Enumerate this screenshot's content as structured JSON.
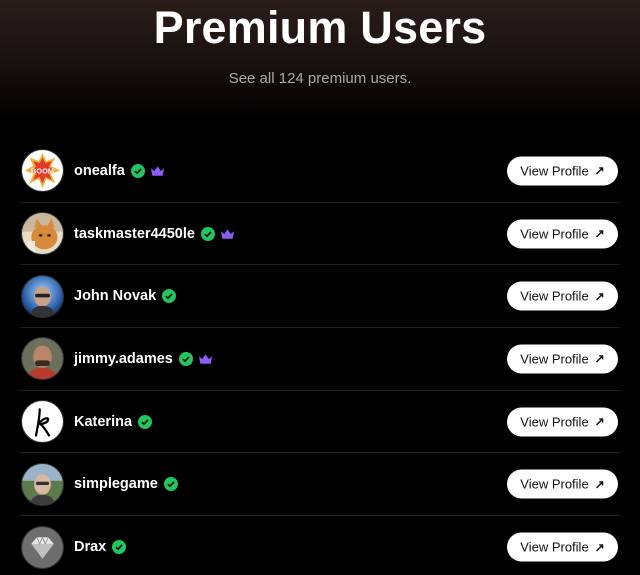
{
  "header": {
    "title": "Premium Users",
    "subtitle": "See all 124 premium users."
  },
  "colors": {
    "verified": "#22c55e",
    "crown": "#8b5cf6",
    "button_bg": "#ffffff",
    "background": "#000000"
  },
  "users": [
    {
      "name": "onealfa",
      "verified": true,
      "premium_crown": true,
      "avatar": "boom-comic-avatar",
      "button": "View Profile"
    },
    {
      "name": "taskmaster4450le",
      "verified": true,
      "premium_crown": true,
      "avatar": "cat-photo-avatar",
      "button": "View Profile"
    },
    {
      "name": "John Novak",
      "verified": true,
      "premium_crown": false,
      "avatar": "man-blue-background-avatar",
      "button": "View Profile"
    },
    {
      "name": "jimmy.adames",
      "verified": true,
      "premium_crown": true,
      "avatar": "bald-man-avatar",
      "button": "View Profile"
    },
    {
      "name": "Katerina",
      "verified": true,
      "premium_crown": false,
      "avatar": "letter-k-avatar",
      "button": "View Profile"
    },
    {
      "name": "simplegame",
      "verified": true,
      "premium_crown": false,
      "avatar": "man-outdoors-avatar",
      "button": "View Profile"
    },
    {
      "name": "Drax",
      "verified": true,
      "premium_crown": false,
      "avatar": "diamond-avatar",
      "button": "View Profile"
    }
  ],
  "icons": {
    "verified": "check-badge-icon",
    "crown": "crown-icon",
    "external": "arrow-up-right-icon"
  }
}
